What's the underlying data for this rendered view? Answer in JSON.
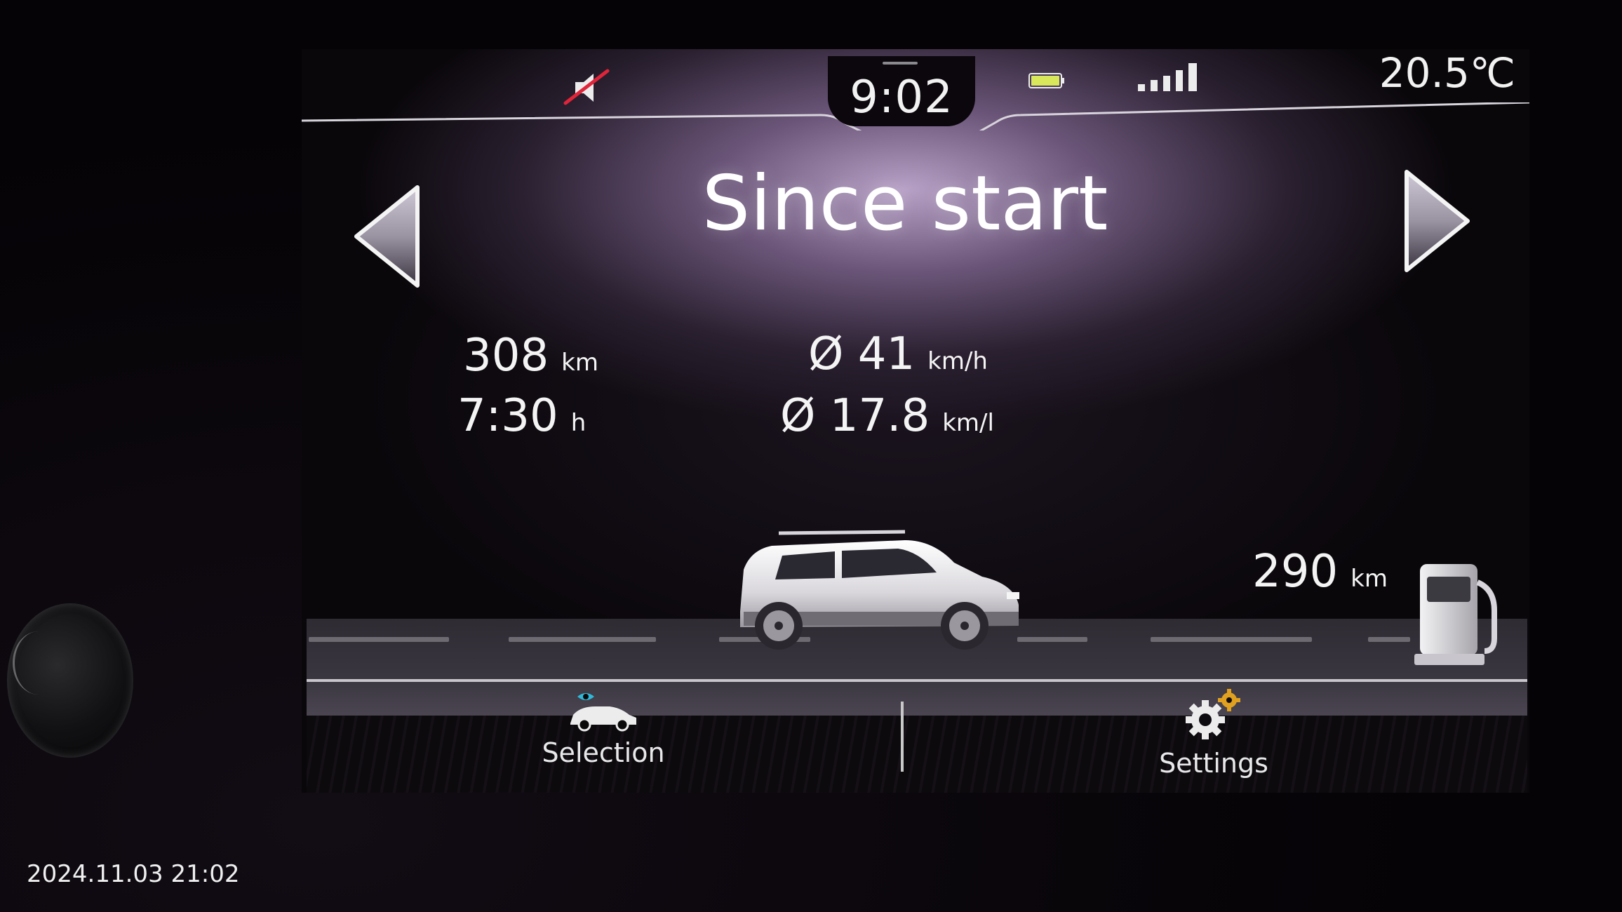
{
  "status_bar": {
    "time": "9:02",
    "temperature": "20.5℃",
    "icons": [
      "mute-icon",
      "battery-icon",
      "signal-icon"
    ],
    "signal_bars": 5,
    "battery_color": "#d9e85a",
    "mute_slash_color": "#e0243a"
  },
  "page": {
    "title": "Since start",
    "nav": {
      "prev": "left-arrow-icon",
      "next": "right-arrow-icon"
    }
  },
  "stats": {
    "distance": {
      "value": "308",
      "unit": "km"
    },
    "duration": {
      "value": "7:30",
      "unit": "h"
    },
    "avg_speed": {
      "value": "Ø 41",
      "unit": "km/h"
    },
    "avg_consumption": {
      "value": "Ø 17.8",
      "unit": "km/l"
    }
  },
  "range": {
    "value": "290",
    "unit": "km",
    "icon": "fuel-pump-icon"
  },
  "bottom_bar": {
    "selection": {
      "label": "Selection",
      "icon": "car-eye-icon",
      "accent": "#2fb9d8"
    },
    "settings": {
      "label": "Settings",
      "icon": "gear-icon",
      "accent": "#e0a020"
    }
  },
  "photo_timestamp": "2024.11.03 21:02"
}
